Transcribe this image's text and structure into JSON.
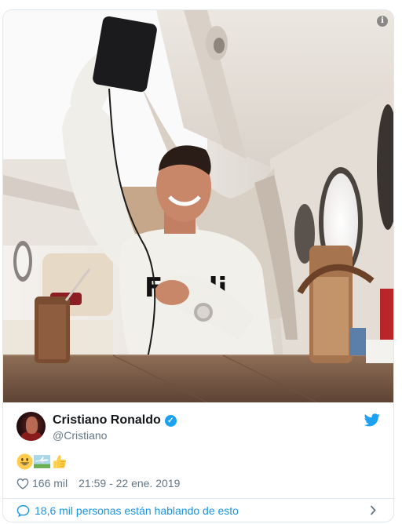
{
  "tweet": {
    "author": {
      "display_name": "Cristiano Ronaldo",
      "handle": "@Cristiano",
      "verified": true
    },
    "text_emojis": [
      "grinning-face-emoji",
      "airplane-emoji",
      "thumbs-up-emoji"
    ],
    "likes": "166 mil",
    "timestamp": "21:59 - 22 ene. 2019",
    "talking_about": "18,6 mil personas están hablando de esto"
  },
  "media": {
    "info_icon_label": "i",
    "alt_sweater_text": "Fendi"
  },
  "colors": {
    "link_blue": "#1b95e0",
    "verified_blue": "#1da1f2",
    "muted_gray": "#657786",
    "border": "#e1e8ed"
  },
  "icons": {
    "verified": "verified-badge-icon",
    "twitter": "twitter-bird-icon",
    "heart": "heart-icon",
    "comment": "comment-bubble-icon",
    "chevron": "chevron-right-icon",
    "info": "info-icon"
  }
}
